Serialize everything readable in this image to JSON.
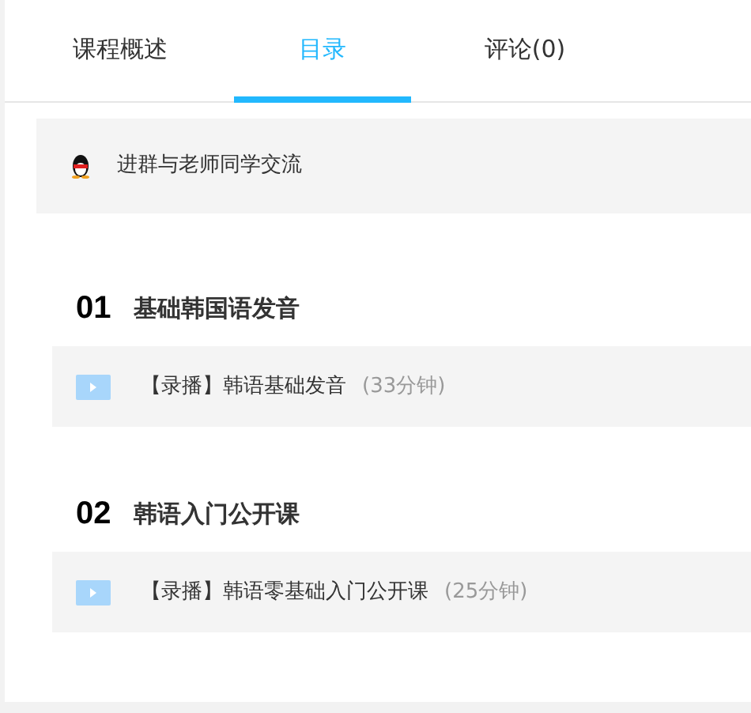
{
  "tabs": [
    {
      "label": "课程概述",
      "selected": false
    },
    {
      "label": "目录",
      "selected": true
    },
    {
      "label": "评论(0)",
      "selected": false
    }
  ],
  "group_banner": {
    "text": "进群与老师同学交流"
  },
  "chapters": [
    {
      "number": "01",
      "title": "基础韩国语发音",
      "lessons": [
        {
          "title": "【录播】韩语基础发音",
          "duration": "(33分钟)"
        }
      ]
    },
    {
      "number": "02",
      "title": "韩语入门公开课",
      "lessons": [
        {
          "title": "【录播】韩语零基础入门公开课",
          "duration": "(25分钟)"
        }
      ]
    }
  ]
}
